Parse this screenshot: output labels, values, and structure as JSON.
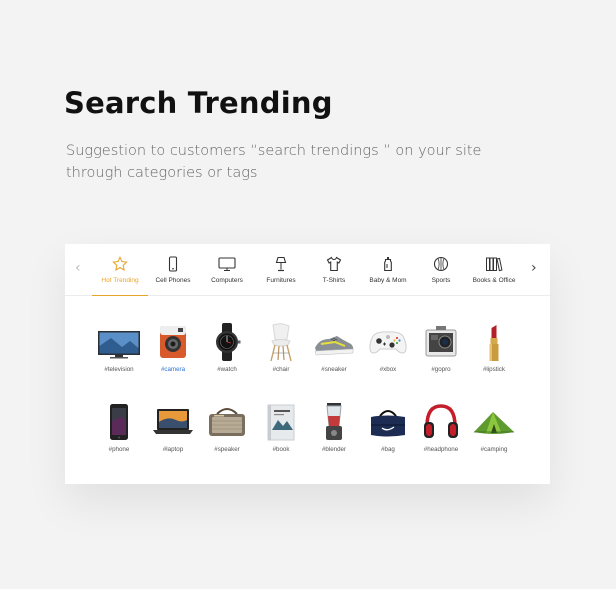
{
  "header": {
    "title": "Search Trending",
    "description": "Suggestion to customers “search trendings ” on your site through categories or tags"
  },
  "categories": [
    {
      "label": "Hot Trending",
      "icon": "star-icon",
      "active": true
    },
    {
      "label": "Cell Phones",
      "icon": "phone-icon",
      "active": false
    },
    {
      "label": "Computers",
      "icon": "monitor-icon",
      "active": false
    },
    {
      "label": "Furnitures",
      "icon": "lamp-icon",
      "active": false
    },
    {
      "label": "T-Shirts",
      "icon": "tshirt-icon",
      "active": false
    },
    {
      "label": "Baby & Mom",
      "icon": "baby-bottle-icon",
      "active": false
    },
    {
      "label": "Sports",
      "icon": "ball-icon",
      "active": false
    },
    {
      "label": "Books & Office",
      "icon": "books-icon",
      "active": false
    }
  ],
  "nav": {
    "prev_icon": "chevron-left-icon",
    "next_icon": "chevron-right-icon",
    "prev": "‹",
    "next": "›"
  },
  "tags": [
    {
      "label": "#television",
      "icon": "television-image"
    },
    {
      "label": "#camera",
      "icon": "camera-image",
      "highlight": true
    },
    {
      "label": "#watch",
      "icon": "watch-image"
    },
    {
      "label": "#chair",
      "icon": "chair-image"
    },
    {
      "label": "#sneaker",
      "icon": "sneaker-image"
    },
    {
      "label": "#xbox",
      "icon": "xbox-image"
    },
    {
      "label": "#gopro",
      "icon": "gopro-image"
    },
    {
      "label": "#lipstick",
      "icon": "lipstick-image"
    },
    {
      "label": "#phone",
      "icon": "phone-image"
    },
    {
      "label": "#laptop",
      "icon": "laptop-image"
    },
    {
      "label": "#speaker",
      "icon": "speaker-image"
    },
    {
      "label": "#book",
      "icon": "book-image"
    },
    {
      "label": "#blender",
      "icon": "blender-image"
    },
    {
      "label": "#bag",
      "icon": "bag-image"
    },
    {
      "label": "#headphone",
      "icon": "headphone-image"
    },
    {
      "label": "#camping",
      "icon": "tent-image"
    }
  ],
  "colors": {
    "accent": "#e8a52e",
    "link": "#2a6fd6"
  }
}
